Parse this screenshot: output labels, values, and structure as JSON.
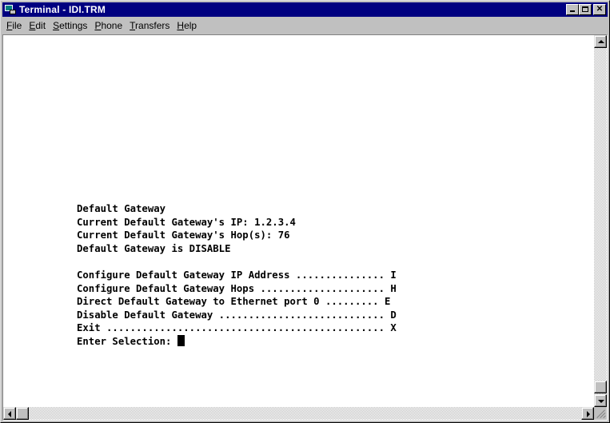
{
  "window": {
    "title": "Terminal - IDI.TRM",
    "icon": "terminal-app-icon",
    "controls": [
      "minimize",
      "maximize",
      "close"
    ]
  },
  "menu": [
    {
      "label": "File",
      "accel": "F",
      "rest": "ile"
    },
    {
      "label": "Edit",
      "accel": "E",
      "rest": "dit"
    },
    {
      "label": "Settings",
      "accel": "S",
      "rest": "ettings"
    },
    {
      "label": "Phone",
      "accel": "P",
      "rest": "hone"
    },
    {
      "label": "Transfers",
      "accel": "T",
      "rest": "ransfers"
    },
    {
      "label": "Help",
      "accel": "H",
      "rest": "elp"
    }
  ],
  "terminal": {
    "header": "Default Gateway",
    "current_ip": "Current Default Gateway's IP: 1.2.3.4",
    "current_hops": "Current Default Gateway's Hop(s): 76",
    "status": "Default Gateway is DISABLE",
    "options": [
      "Configure Default Gateway IP Address ............... I",
      "Configure Default Gateway Hops ..................... H",
      "Direct Default Gateway to Ethernet port 0 ......... E",
      "Disable Default Gateway ............................ D",
      "Exit ............................................... X"
    ],
    "prompt": "Enter Selection: "
  }
}
